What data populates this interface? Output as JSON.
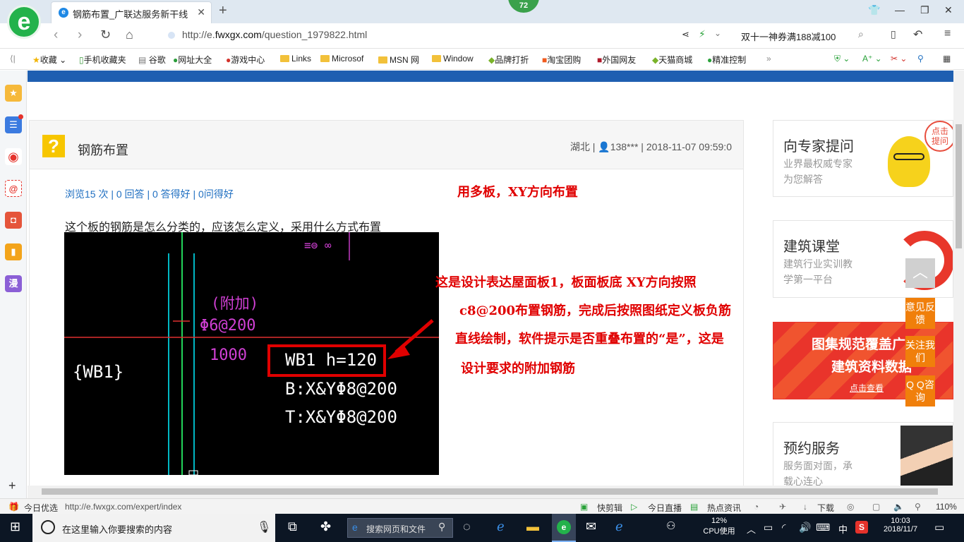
{
  "browser": {
    "tab_title": "钢筋布置_广联达服务新干线",
    "badge": "72",
    "url_prefix": "http://e.",
    "url_domain": "fwxgx.com",
    "url_path": "/question_1979822.html",
    "promo": "双十一神券满188减100"
  },
  "favorites": [
    "收藏",
    "手机收藏夹",
    "谷歌",
    "网址大全",
    "游戏中心",
    "Links",
    "Microsof",
    "MSN 网",
    "Window",
    "品牌打折",
    "淘宝团购",
    "外国网友",
    "天猫商城",
    "精准控制"
  ],
  "question": {
    "title": "钢筋布置",
    "location": "湖北",
    "user": "138***",
    "datetime": "2018-11-07 09:59:0",
    "stats": "浏览15 次 | 0 回答 | 0 答得好 | 0问得好",
    "body": "这个板的钢筋是怎么分类的，应该怎么定义，采用什么方式布置"
  },
  "cad": {
    "wb_label": "{WB1}",
    "extra_top": "(附加)",
    "extra_rebar": "Φ6@200",
    "extra_len": "1000",
    "slab": "WB1 h=120",
    "bottom": "B:X&YΦ8@200",
    "top": "T:X&YΦ8@200"
  },
  "notes": {
    "n1": "用多板，XY方向布置",
    "n2": "这是设计表达屋面板1，板面板底 XY方向按照",
    "n3": "c8@200布置钢筋，完成后按照图纸定义板负筋",
    "n4": "直线绘制，软件提示是否重叠布置的“是”，这是",
    "n5": "设计要求的附加钢筋"
  },
  "sidebar_right": {
    "expert_title": "向专家提问",
    "expert_sub1": "业界最权威专家",
    "expert_sub2": "为您解答",
    "click_bubble": "点击提问",
    "course_title": "建筑课堂",
    "course_sub1": "建筑行业实训教",
    "course_sub2": "学第一平台",
    "banner1": "图集规范覆盖广",
    "banner2": "建筑资料数据",
    "banner_btn": "点击查看",
    "booking_title": "预约服务",
    "booking_sub1": "服务面对面，承",
    "booking_sub2": "载心连心"
  },
  "float_buttons": [
    "意见反馈",
    "关注我们",
    "Q Q咨询"
  ],
  "statusbar": {
    "left": "今日优选",
    "url": "http://e.fwxgx.com/expert/index",
    "items": [
      "快剪辑",
      "今日直播",
      "热点资讯",
      "下载"
    ],
    "zoom": "110%"
  },
  "taskbar": {
    "search_placeholder": "在这里输入你要搜索的内容",
    "browser_search": "搜索网页和文件",
    "cpu_percent": "12%",
    "cpu_label": "CPU使用",
    "ime": "中",
    "time": "10:03",
    "date": "2018/11/7"
  }
}
